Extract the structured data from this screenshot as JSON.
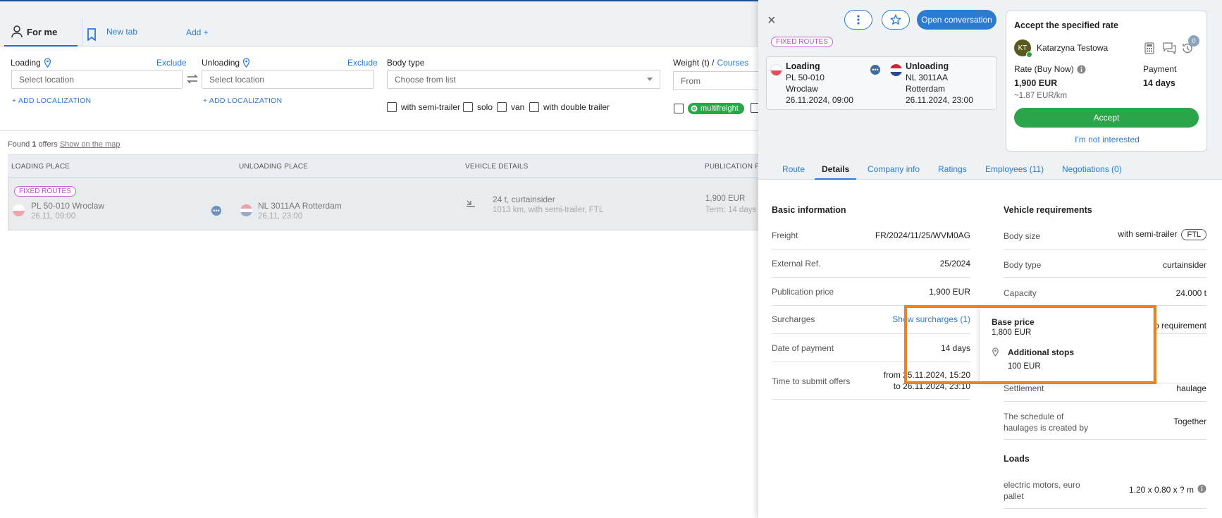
{
  "tabs": {
    "for_me": "For me",
    "new_tab": "New tab",
    "add": "Add +"
  },
  "filters": {
    "loading_label": "Loading",
    "unloading_label": "Unloading",
    "exclude_label": "Exclude",
    "location_placeholder": "Select location",
    "add_localization": "+ ADD LOCALIZATION",
    "body_type_label": "Body type",
    "body_type_placeholder": "Choose from list",
    "weight_label": "Weight (t) /",
    "courses_label": "Courses",
    "from_placeholder": "From",
    "checkboxes": [
      "with semi-trailer",
      "solo",
      "van",
      "with double trailer"
    ],
    "multifreight": "multifreight"
  },
  "results": {
    "found_prefix": "Found",
    "found_count": "1",
    "found_suffix": "offers",
    "show_on_map": "Show on the map",
    "columns": [
      "LOADING PLACE",
      "UNLOADING PLACE",
      "VEHICLE DETAILS",
      "PUBLICATION PRIC"
    ],
    "row": {
      "tag": "FIXED ROUTES",
      "loading_place": "PL 50-010 Wroclaw",
      "loading_date": "26.11, 09:00",
      "unloading_place": "NL 3011AA Rotterdam",
      "unloading_date": "26.11, 23:00",
      "vehicle": "24 t, curtainsider",
      "vehicle_sub": "1013 km, with semi-trailer, FTL",
      "price": "1,900 EUR",
      "term": "Term: 14 days"
    }
  },
  "panel": {
    "open_conversation": "Open conversation",
    "tag": "FIXED ROUTES",
    "route": {
      "loading_label": "Loading",
      "loading_code": "PL 50-010",
      "loading_city": "Wroclaw",
      "loading_date": "26.11.2024, 09:00",
      "unloading_label": "Unloading",
      "unloading_code": "NL 3011AA",
      "unloading_city": "Rotterdam",
      "unloading_date": "26.11.2024, 23:00"
    },
    "rate": {
      "title": "Accept the specified rate",
      "avatar_initials": "KT",
      "user_name": "Katarzyna Testowa",
      "history_count": "0",
      "rate_label": "Rate (Buy Now)",
      "rate_value": "1,900 EUR",
      "per_km": "~1.87 EUR/km",
      "payment_label": "Payment",
      "payment_value": "14 days",
      "accept": "Accept",
      "not_interested": "I'm not interested"
    },
    "tabs": [
      "Route",
      "Details",
      "Company info",
      "Ratings",
      "Employees (11)",
      "Negotiations (0)"
    ],
    "basic": {
      "title": "Basic information",
      "rows": [
        {
          "label": "Freight",
          "value": "FR/2024/11/25/WVM0AG"
        },
        {
          "label": "External Ref.",
          "value": "25/2024"
        },
        {
          "label": "Publication price",
          "value": "1,900 EUR"
        },
        {
          "label": "Surcharges",
          "value": "Show surcharges (1)"
        },
        {
          "label": "Date of payment",
          "value": "14 days"
        },
        {
          "label": "Time to submit offers",
          "value": "from 25.11.2024, 15:20",
          "value2": "to 26.11.2024, 23:10"
        }
      ]
    },
    "vehicle": {
      "title": "Vehicle requirements",
      "body_size_label": "Body size",
      "body_size_value": "with semi-trailer",
      "body_size_badge": "FTL",
      "body_type_label": "Body type",
      "body_type_value": "curtainsider",
      "capacity_label": "Capacity",
      "capacity_value": "24.000 t",
      "no_requirement": "No requirement",
      "settlement_label": "Settlement",
      "settlement_value": "haulage",
      "schedule_label": "The schedule of haulages is created by",
      "schedule_value": "Together"
    },
    "loads": {
      "title": "Loads",
      "item_label": "electric motors, euro pallet",
      "item_value": "1.20 x 0.80 x ? m"
    },
    "tooltip": {
      "base_label": "Base price",
      "base_value": "1,800 EUR",
      "stops_label": "Additional stops",
      "stops_value": "100 EUR"
    }
  },
  "colors": {
    "accent": "#2b7bd3",
    "green": "#2aa549",
    "highlight": "#f08018"
  }
}
